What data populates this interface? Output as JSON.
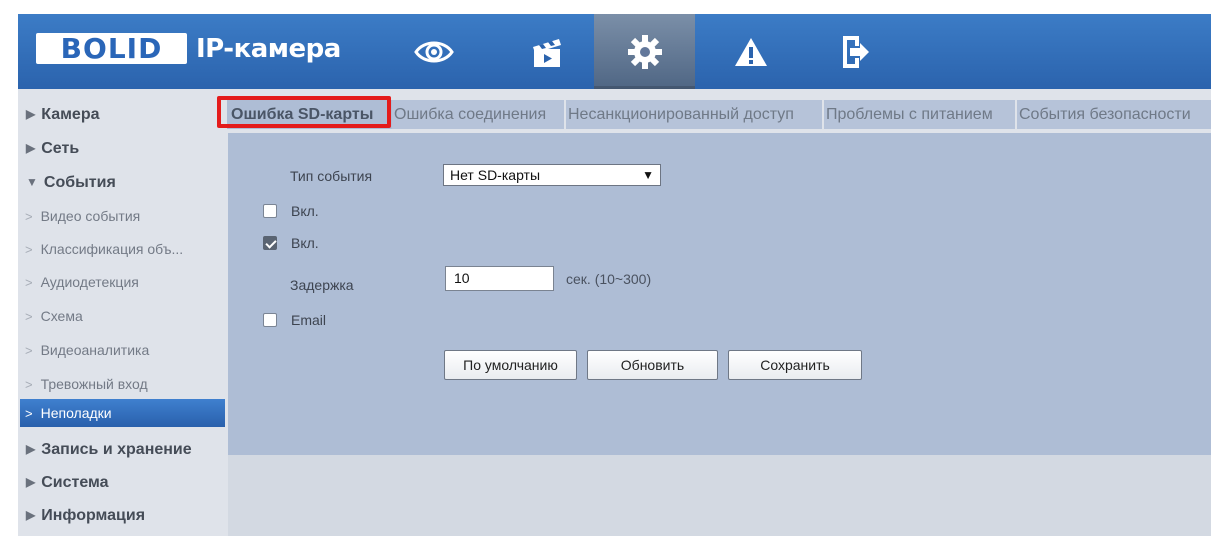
{
  "header": {
    "logo": "BOLID",
    "title": "IP-камера",
    "nav_icons": [
      "eye-icon",
      "clapperboard-icon",
      "gear-icon",
      "warning-icon",
      "logout-icon"
    ],
    "active_nav": "gear-icon",
    "colors": {
      "bar": "#2b63ad",
      "active": "#5d7290"
    }
  },
  "sidebar": {
    "top": [
      {
        "label": "Камера"
      },
      {
        "label": "Сеть"
      },
      {
        "label": "События"
      },
      {
        "label": "Запись и хранение"
      },
      {
        "label": "Система"
      },
      {
        "label": "Информация"
      }
    ],
    "events_children": [
      {
        "label": "Видео события"
      },
      {
        "label": "Классификация объ..."
      },
      {
        "label": "Аудиодетекция"
      },
      {
        "label": "Схема"
      },
      {
        "label": "Видеоаналитика"
      },
      {
        "label": "Тревожный вход"
      },
      {
        "label": "Неполадки"
      }
    ],
    "active_child": "Неполадки"
  },
  "tabs": [
    {
      "label": "Ошибка SD-карты"
    },
    {
      "label": "Ошибка соединения"
    },
    {
      "label": "Несанкционированный доступ"
    },
    {
      "label": "Проблемы с питанием"
    },
    {
      "label": "События безопасности"
    }
  ],
  "active_tab": "Ошибка SD-карты",
  "highlight_color": "#e41b1b",
  "form": {
    "event_type_label": "Тип события",
    "event_type_value": "Нет SD-карты",
    "enable1_label": "Вкл.",
    "enable1_checked": false,
    "enable2_label": "Вкл.",
    "enable2_checked": true,
    "delay_label": "Задержка",
    "delay_value": "10",
    "delay_unit": "сек. (10~300)",
    "email_label": "Email",
    "email_checked": false
  },
  "buttons": {
    "default": "По умолчанию",
    "refresh": "Обновить",
    "save": "Сохранить"
  }
}
